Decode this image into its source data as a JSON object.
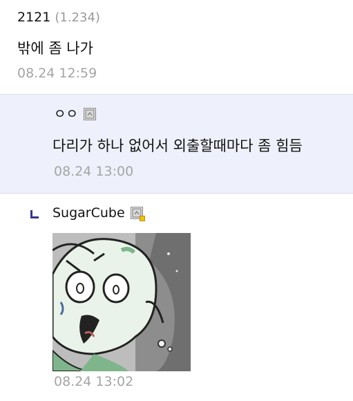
{
  "comments": [
    {
      "nickname": "2121",
      "ip": "(1.234)",
      "text": "밖에 좀 나가",
      "time": "08.24 12:59"
    },
    {
      "nickname": "ㅇㅇ",
      "text": "다리가 하나 없어서 외출할때마다 좀 힘듬",
      "time": "08.24 13:00",
      "icon": "fixed-nick-icon"
    },
    {
      "nickname": "SugarCube",
      "time": "08.24 13:02",
      "icon": "fixed-nick-gold-icon",
      "image": "cartoon-character-reaction-image"
    }
  ],
  "colors": {
    "reply_bg": "#eef1fb",
    "reply_mark": "#33378a",
    "time": "#a5a5a5"
  }
}
